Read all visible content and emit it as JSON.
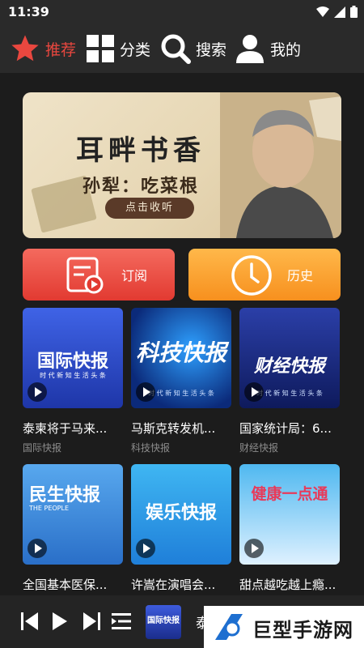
{
  "status": {
    "time": "11:39"
  },
  "nav": {
    "items": [
      {
        "label": "推荐",
        "active": true
      },
      {
        "label": "分类"
      },
      {
        "label": "搜索"
      },
      {
        "label": "我的"
      }
    ]
  },
  "banner": {
    "title": "耳畔书香",
    "subtitle": "孙犁：吃菜根",
    "cta": "点击收听"
  },
  "actions": {
    "subscribe": "订阅",
    "history": "历史"
  },
  "cards": [
    {
      "title": "泰柬将于马来...",
      "category": "国际快报",
      "thumb_text": "国际快报",
      "thumb_sub": "时 代 新 知  生 活 头 条"
    },
    {
      "title": "马斯克转发机...",
      "category": "科技快报",
      "thumb_text": "科技快报",
      "thumb_sub": "时 代 新 知  生 活 头 条"
    },
    {
      "title": "国家统计局：6...",
      "category": "财经快报",
      "thumb_text": "财经快报",
      "thumb_sub": "时 代 新 知  生 活 头 条"
    },
    {
      "title": "全国基本医保...",
      "category": "",
      "thumb_text": "民生快报",
      "thumb_sub": "THE PEOPLE"
    },
    {
      "title": "许嵩在演唱会...",
      "category": "",
      "thumb_text": "娱乐快报",
      "thumb_sub": ""
    },
    {
      "title": "甜点越吃越上瘾...",
      "category": "",
      "thumb_text": "健康一点通",
      "thumb_sub": ""
    }
  ],
  "player": {
    "mini_thumb_text": "国际快报",
    "now_playing": "泰"
  },
  "watermark": {
    "text": "巨型手游网"
  },
  "colors": {
    "accent": "#e9473f",
    "subscribe": "#e23a31",
    "history": "#f7901e",
    "background": "#1c1c1c"
  }
}
